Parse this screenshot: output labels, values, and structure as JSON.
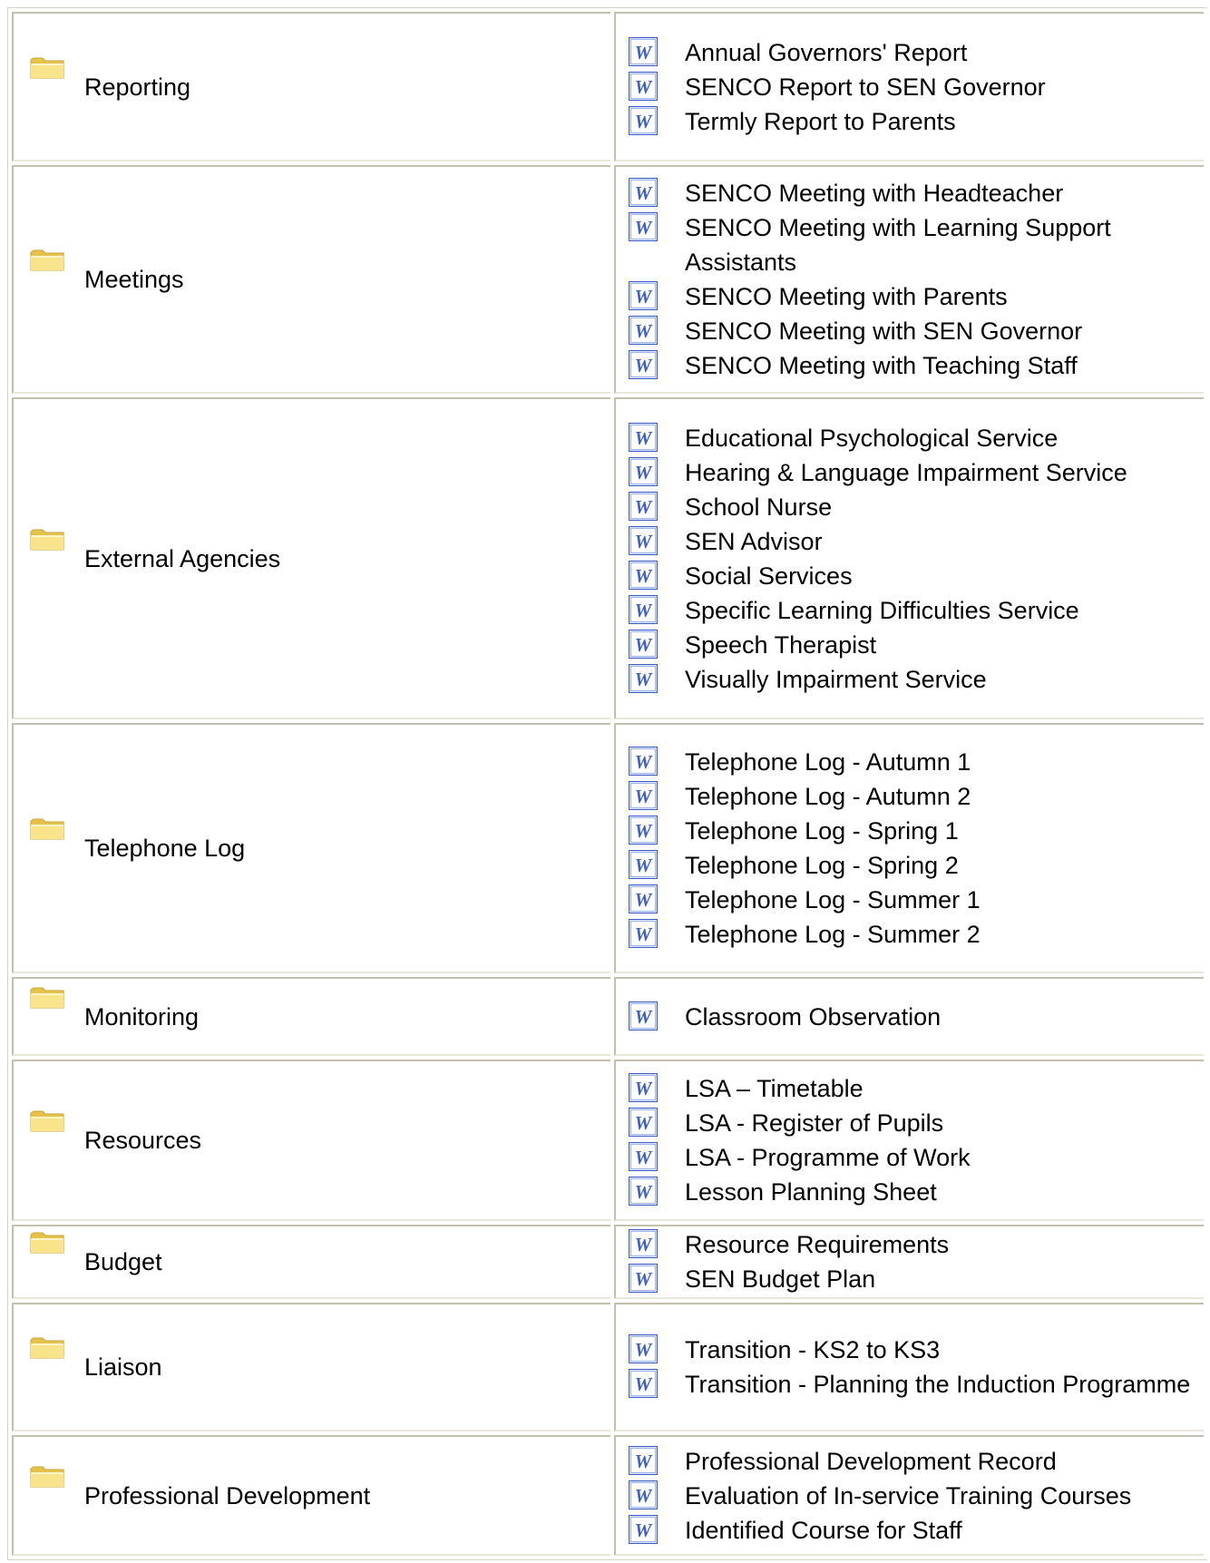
{
  "categories": [
    {
      "name": "Reporting",
      "documents": [
        "Annual Governors' Report",
        "SENCO Report to SEN Governor",
        "Termly Report to Parents"
      ]
    },
    {
      "name": "Meetings",
      "documents": [
        "SENCO Meeting with Headteacher",
        "SENCO Meeting with Learning Support Assistants",
        "SENCO Meeting with Parents",
        "SENCO Meeting with SEN Governor",
        "SENCO Meeting with Teaching Staff"
      ]
    },
    {
      "name": "External Agencies",
      "documents": [
        "Educational Psychological Service",
        "Hearing & Language Impairment Service",
        "School Nurse",
        "SEN Advisor",
        "Social Services",
        "Specific Learning Difficulties Service",
        "Speech Therapist",
        "Visually Impairment Service"
      ]
    },
    {
      "name": "Telephone Log",
      "documents": [
        "Telephone Log  - Autumn 1",
        "Telephone Log  - Autumn 2",
        "Telephone Log  - Spring 1",
        "Telephone Log  - Spring 2",
        "Telephone Log  - Summer 1",
        "Telephone Log  - Summer 2"
      ]
    },
    {
      "name": "Monitoring",
      "documents": [
        "Classroom Observation"
      ]
    },
    {
      "name": "Resources",
      "documents": [
        "LSA – Timetable",
        "LSA - Register of Pupils",
        "LSA - Programme of Work",
        "Lesson Planning Sheet"
      ]
    },
    {
      "name": "Budget",
      "documents": [
        "Resource Requirements",
        "SEN Budget Plan"
      ]
    },
    {
      "name": "Liaison",
      "documents": [
        "Transition - KS2 to KS3",
        "Transition - Planning the Induction Programme"
      ]
    },
    {
      "name": "Professional Development",
      "documents": [
        "Professional Development Record",
        "Evaluation of In-service Training Courses",
        "Identified Course for Staff"
      ]
    }
  ],
  "icons": {
    "category": "folder-icon",
    "document": "word-document-icon"
  },
  "colors": {
    "folder": "#f5dc7a",
    "word_icon": "#3c5fc8",
    "cell_border": "#c3c0ad"
  }
}
